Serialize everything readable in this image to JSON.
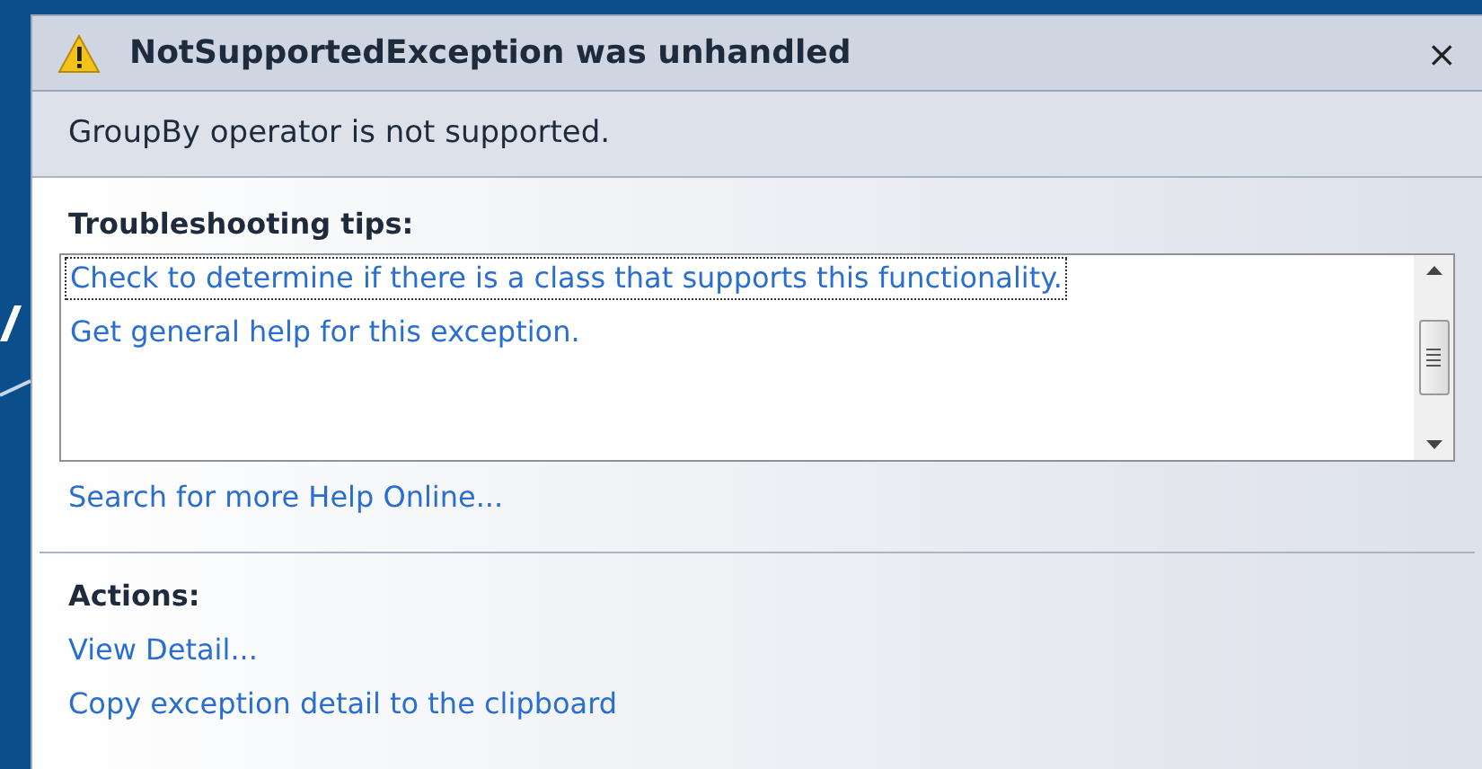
{
  "dialog": {
    "title": "NotSupportedException was unhandled",
    "close": "×",
    "message": "GroupBy operator is not supported."
  },
  "troubleshooting": {
    "heading": "Troubleshooting tips:",
    "tips": [
      {
        "text": "Check to determine if there is a class that supports this functionality.",
        "focused": true
      },
      {
        "text": "Get general help for this exception.",
        "focused": false
      }
    ],
    "search_link": "Search for more Help Online..."
  },
  "actions": {
    "heading": "Actions:",
    "links": [
      "View Detail...",
      "Copy exception detail to the clipboard"
    ]
  }
}
